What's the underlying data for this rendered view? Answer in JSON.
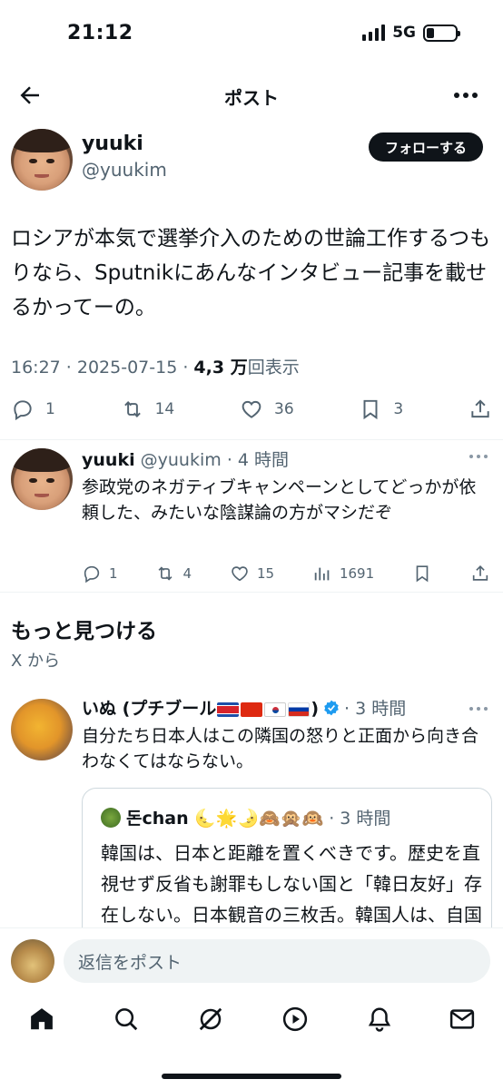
{
  "status_bar": {
    "time": "21:12",
    "network": "5G"
  },
  "header": {
    "title": "ポスト"
  },
  "main_post": {
    "name": "yuuki",
    "handle": "@yuukim",
    "follow_label": "フォローする",
    "text": "ロシアが本気で選挙介入のための世論工作するつもりなら、Sputnikにあんなインタビュー記事を載せるかってーの。",
    "time": "16:27 · 2025-07-15 · ",
    "views": "4,3 万",
    "views_label": "回表示",
    "replies": "1",
    "reposts": "14",
    "likes": "36",
    "bookmarks": "3"
  },
  "reply": {
    "name": "yuuki",
    "handle": "@yuukim",
    "age": "· 4 時間",
    "text": "参政党のネガティブキャンペーンとしてどっかが依頼した、みたいな陰謀論の方がマシだぞ",
    "replies": "1",
    "reposts": "4",
    "likes": "15",
    "views": "1691"
  },
  "discover": {
    "title": "もっと見つける",
    "subtitle": "X から"
  },
  "recommended": {
    "name": "いぬ (プチブール",
    "name_suffix": ")",
    "age": "· 3 時間",
    "text": "自分たち日本人はこの隣国の怒りと正面から向き合わなくてはならない。",
    "quote": {
      "name": "돈chan 🌜🌟🌛🙈🙊🙉",
      "age": "· 3 時間",
      "text": "韓国は、日本と距離を置くべきです。歴史を直視せず反省も謝罪もしない国と「韓日友好」存在しない。日本観音の三枚舌。韓国人は、自国の歴史"
    }
  },
  "composer": {
    "placeholder": "返信をポスト"
  }
}
